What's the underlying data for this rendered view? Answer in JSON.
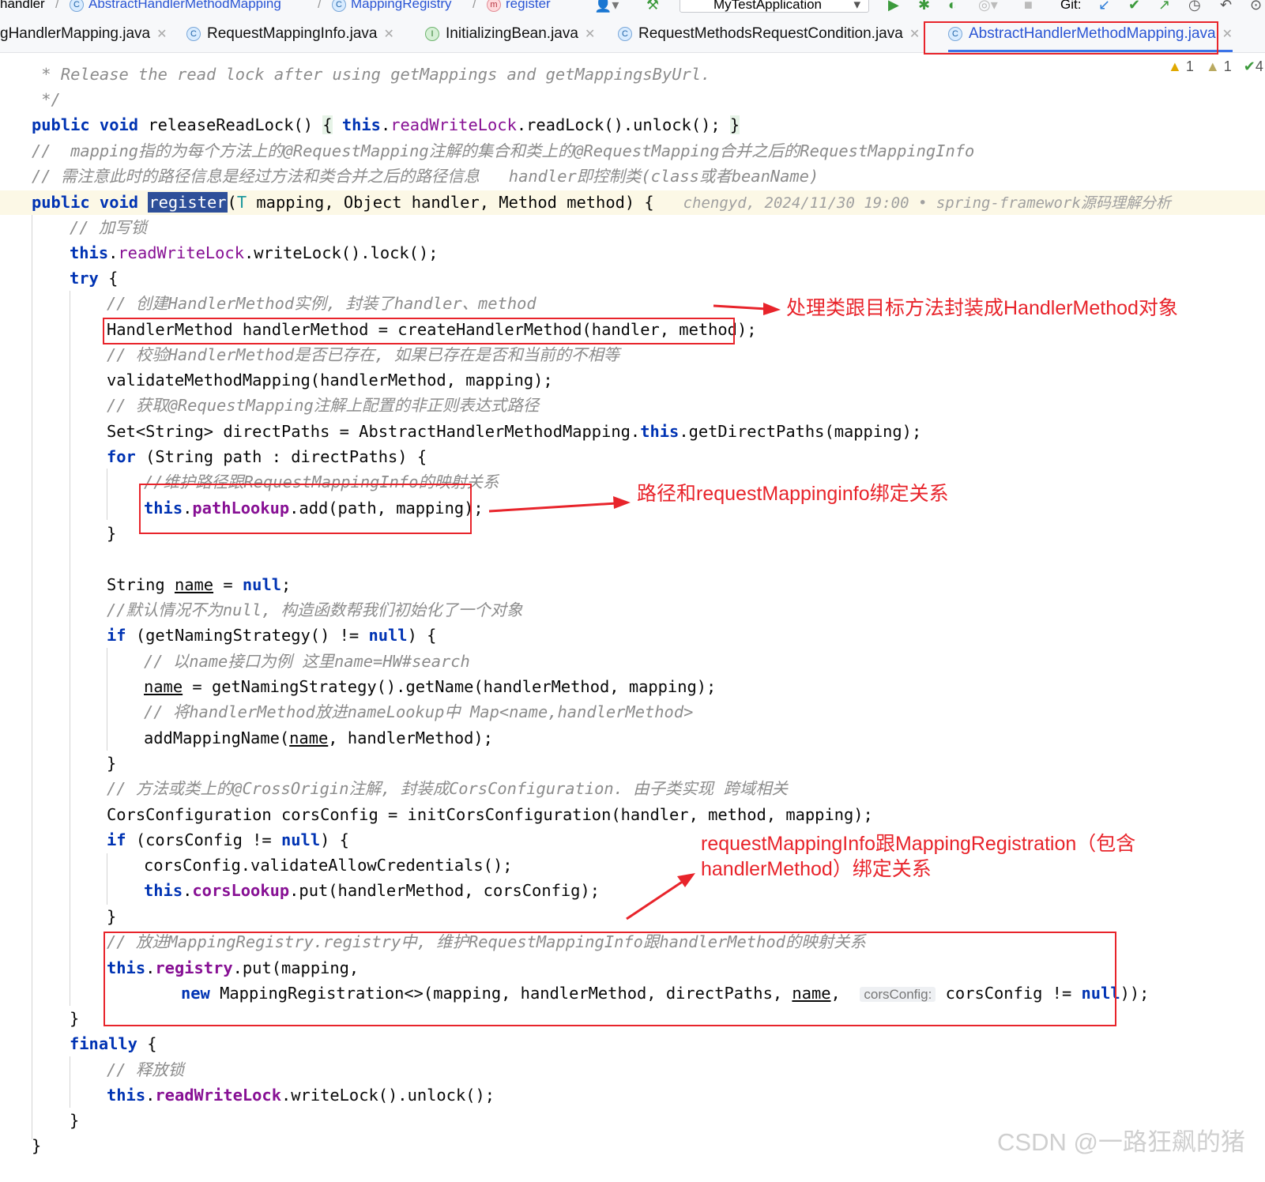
{
  "breadcrumb": {
    "items": [
      "handler",
      "AbstractHandlerMethodMapping",
      "MappingRegistry",
      "register"
    ]
  },
  "toolbar": {
    "run_config": "MyTestApplication",
    "git_label": "Git:"
  },
  "tabs": [
    {
      "label": "gHandlerMapping.java"
    },
    {
      "label": "RequestMappingInfo.java"
    },
    {
      "label": "InitializingBean.java"
    },
    {
      "label": "RequestMethodsRequestCondition.java"
    },
    {
      "label": "AbstractHandlerMethodMapping.java"
    }
  ],
  "inspections": {
    "warnings": "1",
    "weak_warnings": "1",
    "typos": "4"
  },
  "code": {
    "l1": " * Release the read lock after using getMappings and getMappingsByUrl.",
    "l2": " */",
    "l3a": "public void",
    "l3b": " releaseReadLock() ",
    "l3c": "{",
    "l3d": " this",
    "l3e": ".",
    "l3f": "readWriteLock",
    "l3g": ".readLock().unlock(); ",
    "l3h": "}",
    "l4": "//  mapping指的为每个方法上的@RequestMapping注解的集合和类上的@RequestMapping合并之后的RequestMappingInfo",
    "l5": "// 需注意此时的路径信息是经过方法和类合并之后的路径信息   handler即控制类(class或者beanName)",
    "l6a": "public void",
    "l6b": "register",
    "l6c": "(",
    "l6d": "T",
    "l6e": " mapping, Object handler, Method method) {",
    "l6f": "chengyd, 2024/11/30 19:00 • spring-framework源码理解分析",
    "l7": "// 加写锁",
    "l8a": "this",
    "l8b": ".",
    "l8c": "readWriteLock",
    "l8d": ".writeLock().lock();",
    "l9a": "try",
    "l9b": " {",
    "l10": "// 创建HandlerMethod实例, 封装了handler、method",
    "l11": "HandlerMethod handlerMethod = createHandlerMethod(handler, method);",
    "l12": "// 校验HandlerMethod是否已存在, 如果已存在是否和当前的不相等",
    "l13": "validateMethodMapping(handlerMethod, mapping);",
    "l14": "// 获取@RequestMapping注解上配置的非正则表达式路径",
    "l15a": "Set<String> directPaths = AbstractHandlerMethodMapping.",
    "l15b": "this",
    "l15c": ".getDirectPaths(mapping);",
    "l16a": "for",
    "l16b": " (String path : directPaths) {",
    "l17": "//维护路径跟RequestMappingInfo的映射关系",
    "l18a": "this",
    "l18b": ".",
    "l18c": "pathLookup",
    "l18d": ".add(path, mapping);",
    "l19": "}",
    "l20a": "String ",
    "l20b": "name",
    "l20c": " = ",
    "l20d": "null",
    "l20e": ";",
    "l21": "//默认情况不为null, 构造函数帮我们初始化了一个对象",
    "l22a": "if",
    "l22b": " (getNamingStrategy() != ",
    "l22c": "null",
    "l22d": ") {",
    "l23": "// 以name接口为例 这里name=HW#search",
    "l24a": "name",
    "l24b": " = getNamingStrategy().getName(handlerMethod, mapping);",
    "l25": "// 将handlerMethod放进nameLookup中 Map<name,handlerMethod>",
    "l26a": "addMappingName(",
    "l26b": "name",
    "l26c": ", handlerMethod);",
    "l27": "}",
    "l28": "// 方法或类上的@CrossOrigin注解, 封装成CorsConfiguration. 由子类实现 跨域相关",
    "l29": "CorsConfiguration corsConfig = initCorsConfiguration(handler, method, mapping);",
    "l30a": "if",
    "l30b": " (corsConfig != ",
    "l30c": "null",
    "l30d": ") {",
    "l31": "corsConfig.validateAllowCredentials();",
    "l32a": "this",
    "l32b": ".",
    "l32c": "corsLookup",
    "l32d": ".put(handlerMethod, corsConfig);",
    "l33": "}",
    "l34": "// 放进MappingRegistry.registry中, 维护RequestMappingInfo跟handlerMethod的映射关系",
    "l35a": "this",
    "l35b": ".",
    "l35c": "registry",
    "l35d": ".put(mapping,",
    "l36a": "new",
    "l36b": " MappingRegistration<>(mapping, handlerMethod, directPaths, ",
    "l36c": "name",
    "l36d": ", ",
    "l36e": "corsConfig:",
    "l36f": " corsConfig != ",
    "l36g": "null",
    "l36h": "));",
    "l37": "}",
    "l38a": "finally",
    "l38b": " {",
    "l39": "// 释放锁",
    "l40a": "this",
    "l40b": ".",
    "l40c": "readWriteLock",
    "l40d": ".writeLock().unlock();",
    "l41": "}",
    "l42": "}"
  },
  "annotations": {
    "a1": "处理类跟目标方法封装成HandlerMethod对象",
    "a2": "路径和requestMappinginfo绑定关系",
    "a3_line1": "requestMappingInfo跟MappingRegistration（包含",
    "a3_line2": "handlerMethod）绑定关系"
  },
  "watermark": "CSDN @一路狂飙的猪",
  "colors": {
    "keyword": "#0033b3",
    "field": "#871094",
    "comment": "#8c8c8c",
    "annotation_red": "#e8242b",
    "active_tab": "#2a55d4"
  }
}
